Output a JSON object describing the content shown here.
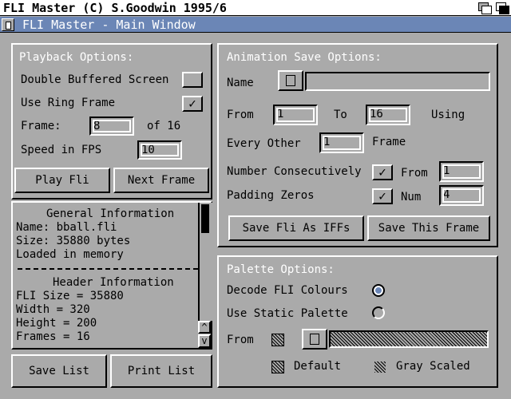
{
  "screen": {
    "title": "FLI Master (C) S.Goodwin 1995/6"
  },
  "window": {
    "title": "FLI Master - Main Window"
  },
  "playback": {
    "heading": "Playback Options:",
    "double_buffered_label": "Double Buffered Screen",
    "double_buffered_checked": "",
    "ring_frame_label": "Use Ring Frame",
    "ring_frame_checked": "✓",
    "frame_label": "Frame:",
    "frame_value": "8",
    "frame_of": "of 16",
    "speed_label": "Speed in FPS",
    "speed_value": "10",
    "play_button": "Play Fli",
    "next_button": "Next Frame"
  },
  "info": {
    "lines": [
      "General Information",
      "Name: bball.fli",
      "Size: 35880 bytes",
      "Loaded in memory",
      "Header Information",
      "FLI Size = 35880",
      "Width = 320",
      "Height = 200",
      "Frames = 16"
    ],
    "scroll_up": "^",
    "scroll_down": "v"
  },
  "list_buttons": {
    "save": "Save List",
    "print": "Print List"
  },
  "anim_save": {
    "heading": "Animation Save Options:",
    "name_label": "Name",
    "name_value": "",
    "from_label": "From",
    "from_value": "1",
    "to_label": "To",
    "to_value": "16",
    "using_label": "Using",
    "every_other_label": "Every Other",
    "every_other_value": "1",
    "frame_label": "Frame",
    "number_consec_label": "Number Consecutively",
    "number_consec_checked": "✓",
    "nc_from_label": "From",
    "nc_from_value": "1",
    "padding_label": "Padding Zeros",
    "padding_checked": "✓",
    "num_label": "Num",
    "num_value": "4",
    "save_iffs_button": "Save Fli As IFFs",
    "save_frame_button": "Save This Frame"
  },
  "palette": {
    "heading": "Palette Options:",
    "decode_label": "Decode FLI Colours",
    "decode_selected": true,
    "static_label": "Use Static Palette",
    "static_selected": false,
    "from_label": "From",
    "default_label": "Default",
    "gray_label": "Gray Scaled"
  },
  "colors": {
    "window_bg": "#aaaaaa",
    "title_blue": "#6b86b6",
    "highlight": "#ffffff",
    "shadow": "#000000"
  }
}
